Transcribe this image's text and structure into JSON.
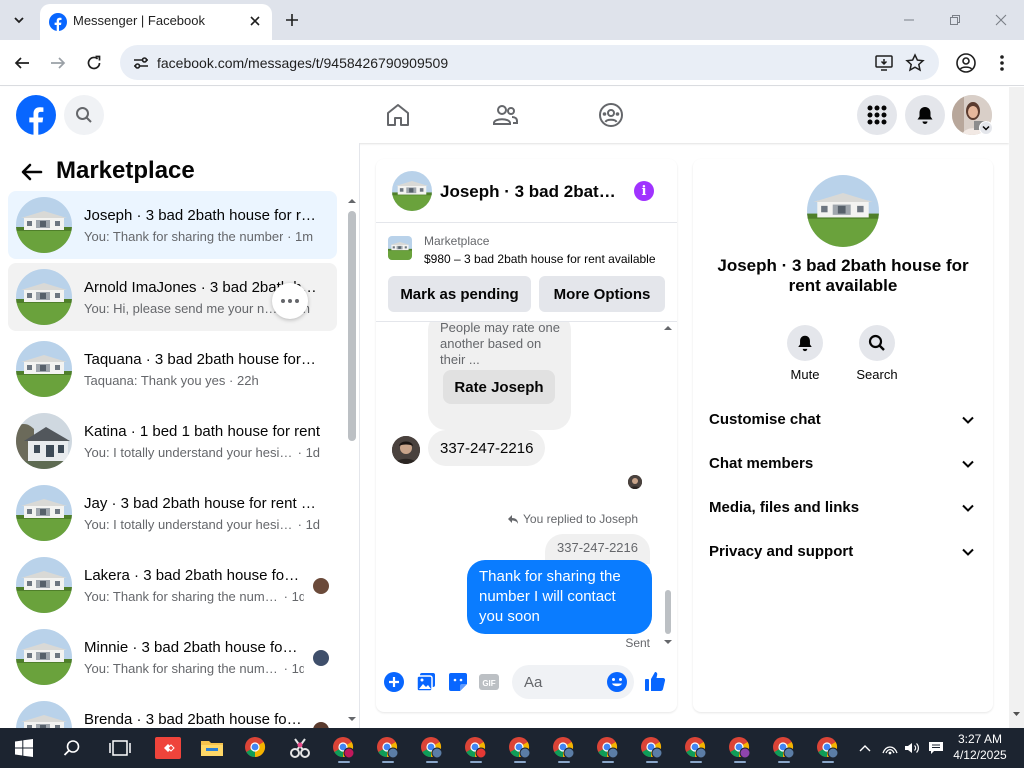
{
  "browser": {
    "tab_title": "Messenger | Facebook",
    "url": "facebook.com/messages/t/9458426790909509"
  },
  "sidebar": {
    "title": "Marketplace",
    "conversations": [
      {
        "name": "Joseph · 3 bad 2bath house for rent available",
        "snippet": "You: Thank for sharing the number",
        "time": "1m",
        "state": "active"
      },
      {
        "name": "Arnold ImaJones · 3 bad 2bath house for rent available",
        "snippet": "You: Hi, please send me your number",
        "time": "1h",
        "state": "hover"
      },
      {
        "name": "Taquana · 3 bad 2bath house for rent available",
        "snippet": "Taquana: Thank you yes",
        "time": "22h",
        "state": ""
      },
      {
        "name": "Katina · 1 bed 1 bath house for rent",
        "snippet": "You: I totally understand your hesitation",
        "time": "1d",
        "state": ""
      },
      {
        "name": "Jay · 3 bad 2bath house for rent available",
        "snippet": "You: I totally understand your hesitation",
        "time": "1d",
        "state": ""
      },
      {
        "name": "Lakera · 3 bad 2bath house for rent available",
        "snippet": "You: Thank for sharing the number",
        "time": "1d",
        "state": ""
      },
      {
        "name": "Minnie · 3 bad 2bath house for rent available",
        "snippet": "You: Thank for sharing the number",
        "time": "1d",
        "state": ""
      },
      {
        "name": "Brenda · 3 bad 2bath house for rent available",
        "snippet": "",
        "time": "",
        "state": ""
      }
    ]
  },
  "chat": {
    "name": "Joseph · 3 bad 2bath house for rent available",
    "marketplace_label": "Marketplace",
    "listing": "$980 – 3 bad 2bath house for rent available",
    "mark_pending": "Mark as pending",
    "more_options": "More Options",
    "rate_text": "People may rate one another based on their ...",
    "rate_button": "Rate Joseph",
    "incoming_message": "337-247-2216",
    "replied_label": "You replied to Joseph",
    "quoted_message": "337-247-2216",
    "outgoing_message": "Thank for sharing  the number I will contact you soon",
    "sent_label": "Sent",
    "composer_placeholder": "Aa"
  },
  "info": {
    "name": "Joseph · 3 bad 2bath house for rent available",
    "mute_label": "Mute",
    "search_label": "Search",
    "sections": [
      "Customise chat",
      "Chat members",
      "Media, files and links",
      "Privacy and support"
    ]
  },
  "taskbar": {
    "time": "3:27 AM",
    "date": "4/12/2025"
  },
  "colors": {
    "facebook_blue": "#0866ff",
    "messenger_bubble": "#0a7cff",
    "info_purple": "#a033ff"
  }
}
